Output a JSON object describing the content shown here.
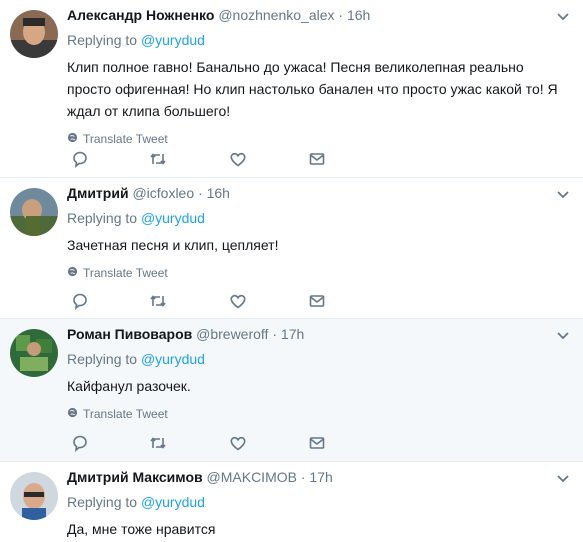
{
  "tweets": [
    {
      "name": "Александр Ножненко",
      "handle": "@nozhnenko_alex",
      "dot": "·",
      "time": "16h",
      "replying_prefix": "Replying to",
      "replying_to": "@yurydud",
      "text": "Клип полное гавно! Банально до ужаса! Песня великолепная реально просто офигенная! Но клип настолько банален что просто ужас какой то! Я ждал от клипа большего!",
      "translate": "Translate Tweet",
      "highlighted": false
    },
    {
      "name": "Дмитрий",
      "handle": "@icfoxleo",
      "dot": "·",
      "time": "16h",
      "replying_prefix": "Replying to",
      "replying_to": "@yurydud",
      "text": "Зачетная песня и клип, цепляет!",
      "translate": "Translate Tweet",
      "highlighted": false
    },
    {
      "name": "Роман Пивоваров",
      "handle": "@breweroff",
      "dot": "·",
      "time": "17h",
      "replying_prefix": "Replying to",
      "replying_to": "@yurydud",
      "text": "Кайфанул разочек.",
      "translate": "Translate Tweet",
      "highlighted": true
    },
    {
      "name": "Дмитрий Максимов",
      "handle": "@MAKCIMOB",
      "dot": "·",
      "time": "17h",
      "replying_prefix": "Replying to",
      "replying_to": "@yurydud",
      "text": "Да, мне тоже нравится",
      "highlighted": false
    }
  ],
  "colors": {
    "link": "#1da1f2",
    "secondary": "#657786",
    "highlight_bg": "#f5f8fa",
    "border": "#e6ecf0"
  },
  "icons": {
    "reply": "reply-icon",
    "retweet": "retweet-icon",
    "like": "heart-icon",
    "dm": "envelope-icon",
    "menu": "chevron-down-icon",
    "translate": "globe-icon"
  }
}
